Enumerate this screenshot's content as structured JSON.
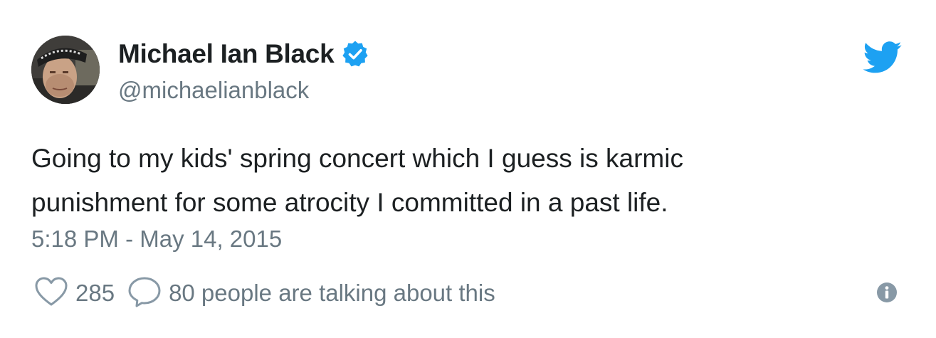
{
  "author": {
    "display_name": "Michael Ian Black",
    "handle": "@michaelianblack",
    "verified": true
  },
  "tweet": {
    "text_lines": [
      "Going to my kids' spring concert which I guess is karmic",
      "punishment for some atrocity I committed in a past life."
    ],
    "timestamp": "5:18 PM - May 14, 2015"
  },
  "actions": {
    "like_count": "285",
    "conversation_text": "80 people are talking about this"
  },
  "icons": {
    "brand": "twitter-bird-icon",
    "verified": "verified-badge-icon",
    "like": "heart-icon",
    "reply": "speech-bubble-icon",
    "info": "info-icon"
  },
  "colors": {
    "brand_blue": "#1da1f2",
    "text_primary": "#1c2022",
    "text_secondary": "#697882",
    "icon_gray": "#8899a6"
  }
}
